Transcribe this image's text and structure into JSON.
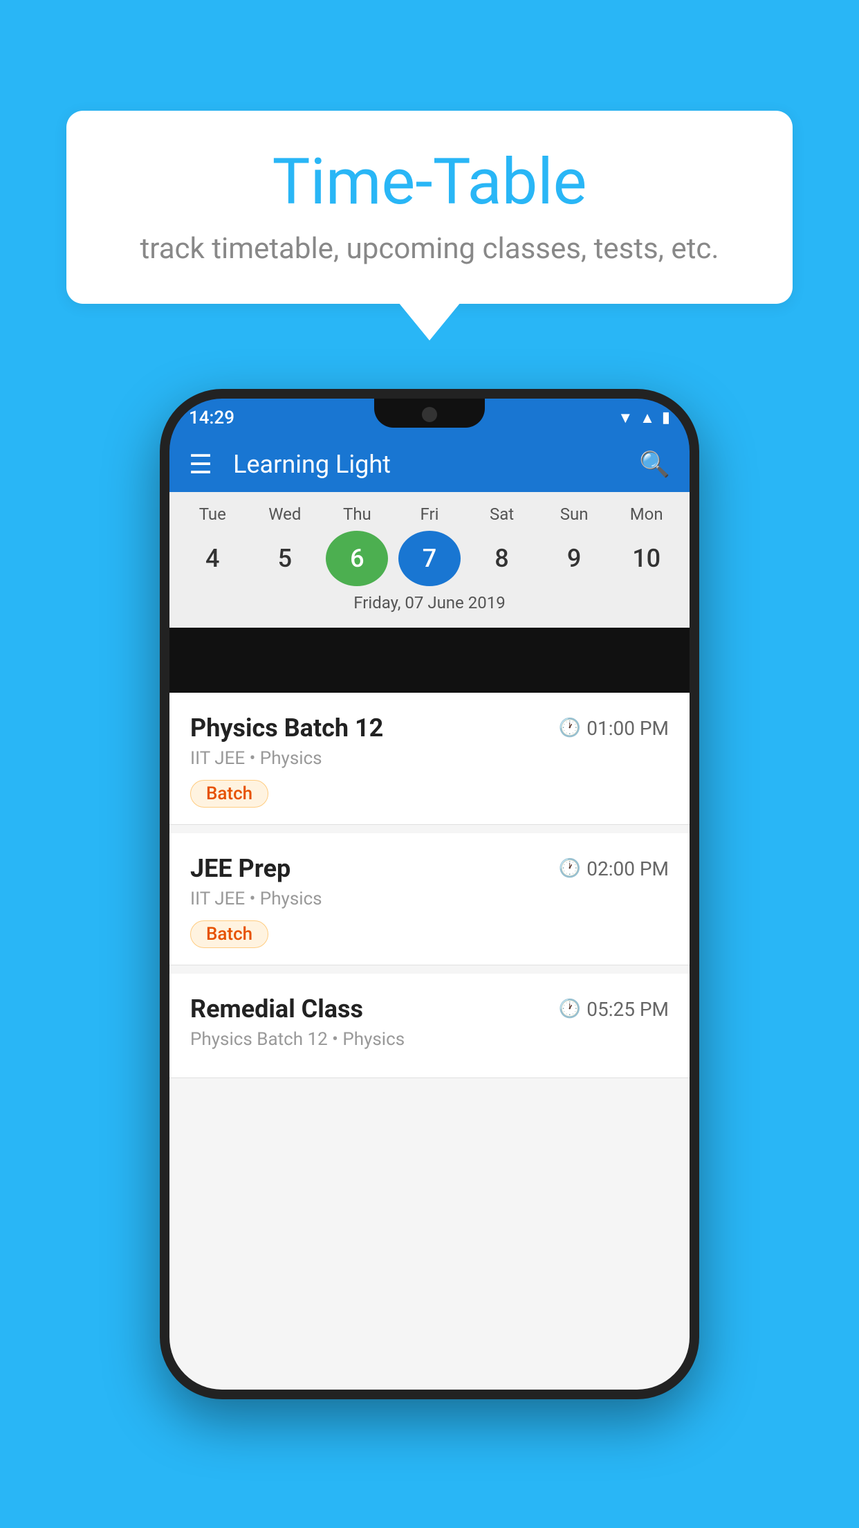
{
  "background_color": "#29B6F6",
  "speech_bubble": {
    "title": "Time-Table",
    "subtitle": "track timetable, upcoming classes, tests, etc."
  },
  "phone": {
    "status_bar": {
      "time": "14:29",
      "icons": [
        "wifi",
        "signal",
        "battery"
      ]
    },
    "toolbar": {
      "title": "Learning Light",
      "menu_icon": "☰",
      "search_icon": "🔍"
    },
    "calendar": {
      "days": [
        {
          "label": "Tue",
          "number": "4"
        },
        {
          "label": "Wed",
          "number": "5"
        },
        {
          "label": "Thu",
          "number": "6",
          "state": "today"
        },
        {
          "label": "Fri",
          "number": "7",
          "state": "selected"
        },
        {
          "label": "Sat",
          "number": "8"
        },
        {
          "label": "Sun",
          "number": "9"
        },
        {
          "label": "Mon",
          "number": "10"
        }
      ],
      "selected_date_label": "Friday, 07 June 2019"
    },
    "schedule": [
      {
        "title": "Physics Batch 12",
        "time": "01:00 PM",
        "subtitle": "IIT JEE • Physics",
        "badge": "Batch"
      },
      {
        "title": "JEE Prep",
        "time": "02:00 PM",
        "subtitle": "IIT JEE • Physics",
        "badge": "Batch"
      },
      {
        "title": "Remedial Class",
        "time": "05:25 PM",
        "subtitle": "Physics Batch 12 • Physics",
        "badge": ""
      }
    ]
  }
}
